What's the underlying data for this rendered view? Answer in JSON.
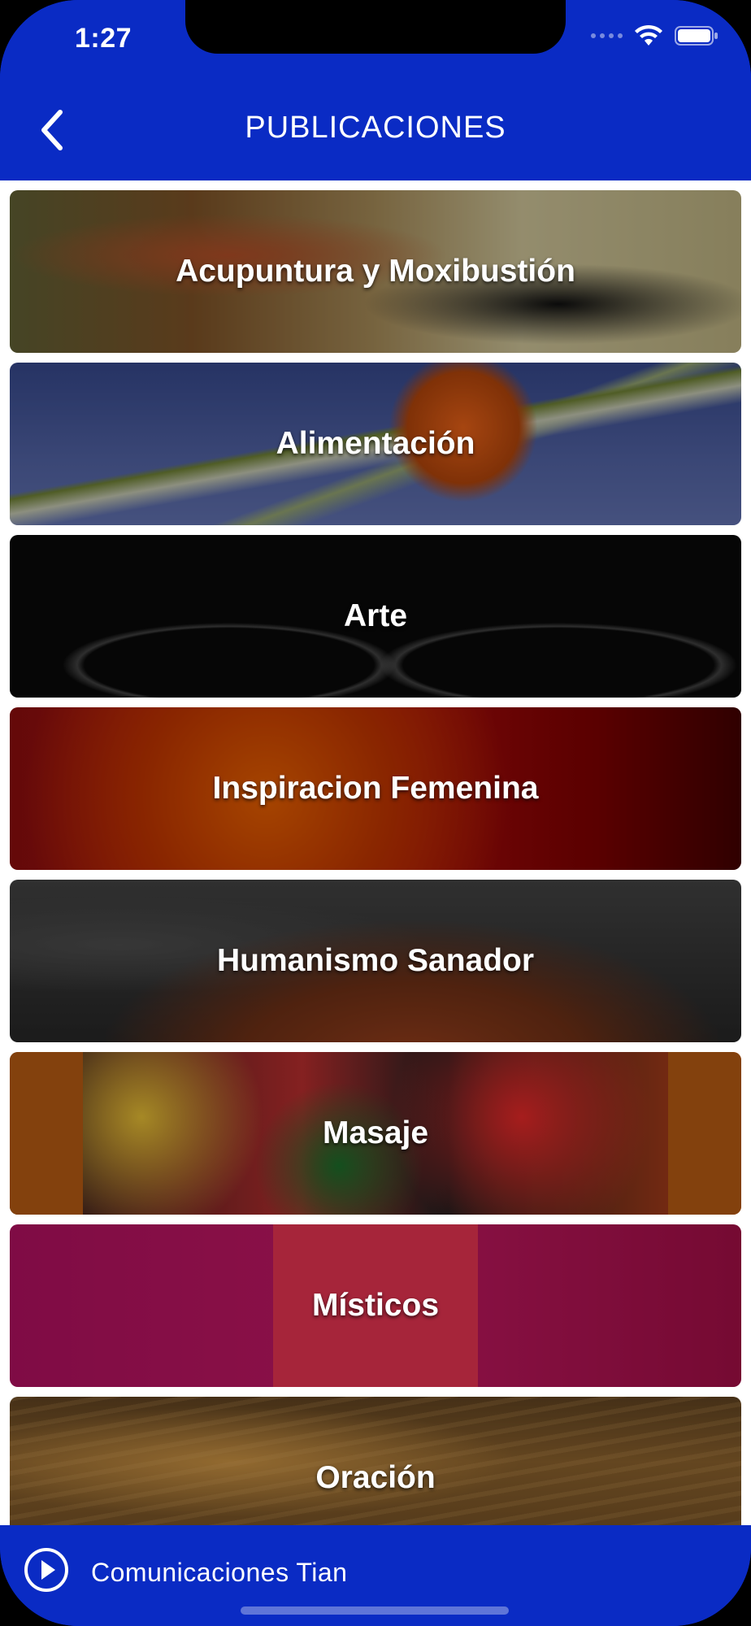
{
  "status_bar": {
    "time": "1:27",
    "icons": [
      "signal-dots-icon",
      "wifi-icon",
      "battery-icon"
    ]
  },
  "nav": {
    "title": "PUBLICACIONES",
    "back_icon": "chevron-left-icon"
  },
  "categories": [
    {
      "label": "Acupuntura y Moxibustión"
    },
    {
      "label": "Alimentación"
    },
    {
      "label": "Arte"
    },
    {
      "label": "Inspiracion Femenina"
    },
    {
      "label": "Humanismo Sanador"
    },
    {
      "label": "Masaje"
    },
    {
      "label": "Místicos"
    },
    {
      "label": "Oración"
    }
  ],
  "player": {
    "title": "Comunicaciones Tian",
    "play_icon": "play-circle-icon"
  },
  "colors": {
    "brand": "#0a2bc4",
    "text": "#ffffff",
    "content_bg": "#ffffff"
  }
}
